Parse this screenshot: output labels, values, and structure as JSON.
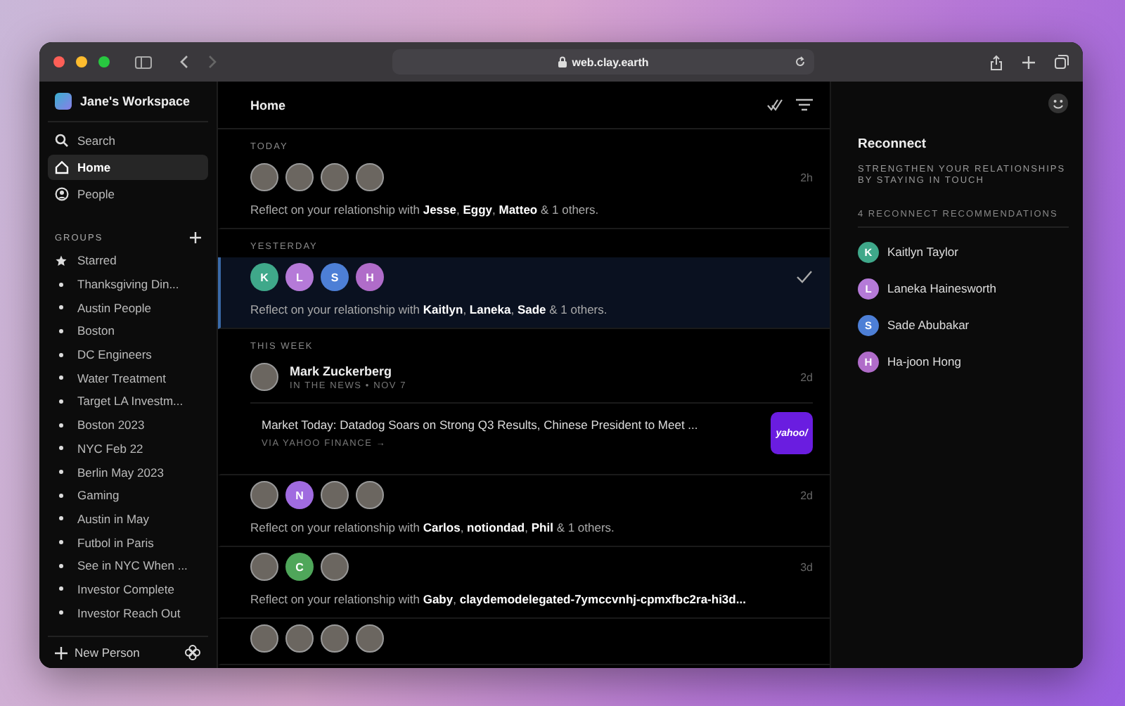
{
  "browser": {
    "url": "web.clay.earth"
  },
  "sidebar": {
    "workspace": "Jane's Workspace",
    "nav": [
      {
        "label": "Search",
        "kind": "search",
        "selected": false
      },
      {
        "label": "Home",
        "kind": "home",
        "selected": true
      },
      {
        "label": "People",
        "kind": "people",
        "selected": false
      }
    ],
    "groups_title": "GROUPS",
    "groups": [
      {
        "label": "Starred",
        "kind": "starred"
      },
      {
        "label": "Thanksgiving Din...",
        "kind": "group"
      },
      {
        "label": "Austin People",
        "kind": "group"
      },
      {
        "label": "Boston",
        "kind": "group"
      },
      {
        "label": "DC Engineers",
        "kind": "group"
      },
      {
        "label": "Water Treatment",
        "kind": "group"
      },
      {
        "label": "Target LA Investm...",
        "kind": "group"
      },
      {
        "label": "Boston 2023",
        "kind": "group"
      },
      {
        "label": "NYC Feb 22",
        "kind": "group"
      },
      {
        "label": "Berlin May 2023",
        "kind": "group"
      },
      {
        "label": "Gaming",
        "kind": "group"
      },
      {
        "label": "Austin in May",
        "kind": "group"
      },
      {
        "label": "Futbol in Paris",
        "kind": "group"
      },
      {
        "label": "See in NYC When ...",
        "kind": "group"
      },
      {
        "label": "Investor Complete",
        "kind": "group"
      },
      {
        "label": "Investor Reach Out",
        "kind": "group"
      }
    ],
    "new_person": "New Person"
  },
  "main": {
    "title": "Home",
    "sections": [
      {
        "label": "TODAY",
        "items": [
          {
            "kind": "reflect",
            "selected": false,
            "time": "2h",
            "avatars": [
              {
                "kind": "photo"
              },
              {
                "kind": "photo"
              },
              {
                "kind": "photo"
              },
              {
                "kind": "photo"
              }
            ],
            "text": "Reflect on your relationship with **Jesse**, **Eggy**, **Matteo** & 1 others."
          }
        ]
      },
      {
        "label": "YESTERDAY",
        "items": [
          {
            "kind": "reflect",
            "selected": true,
            "avatars": [
              {
                "kind": "letter",
                "letter": "K",
                "color": "#3fa88a"
              },
              {
                "kind": "letter",
                "letter": "L",
                "color": "#b57ad8"
              },
              {
                "kind": "letter",
                "letter": "S",
                "color": "#4d7fd6"
              },
              {
                "kind": "letter",
                "letter": "H",
                "color": "#b06cc9"
              }
            ],
            "text": "Reflect on your relationship with **Kaitlyn**, **Laneka**, **Sade** & 1 others."
          }
        ]
      },
      {
        "label": "THIS WEEK",
        "items": [
          {
            "kind": "news",
            "selected": false,
            "time": "2d",
            "name": "Mark Zuckerberg",
            "meta": "IN THE NEWS • NOV 7",
            "headline": "Market Today: Datadog Soars on Strong Q3 Results, Chinese President to Meet ...",
            "source": "VIA YAHOO FINANCE →",
            "logo": "yahoo/"
          },
          {
            "kind": "reflect",
            "selected": false,
            "time": "2d",
            "avatars": [
              {
                "kind": "photo"
              },
              {
                "kind": "letter",
                "letter": "N",
                "color": "#a06be0"
              },
              {
                "kind": "photo"
              },
              {
                "kind": "photo"
              }
            ],
            "text": "Reflect on your relationship with **Carlos**, **notiondad**, **Phil** & 1 others."
          },
          {
            "kind": "reflect",
            "selected": false,
            "time": "3d",
            "avatars": [
              {
                "kind": "photo"
              },
              {
                "kind": "letter",
                "letter": "C",
                "color": "#4fa65a"
              },
              {
                "kind": "photo"
              }
            ],
            "text": "Reflect on your relationship with **Gaby**, **claydemodelegated-7ymccvnhj-cpmxfbc2ra-hi3d...**"
          },
          {
            "kind": "reflect",
            "selected": false,
            "avatars": [
              {
                "kind": "photo"
              },
              {
                "kind": "photo"
              },
              {
                "kind": "photo"
              },
              {
                "kind": "photo"
              }
            ]
          }
        ]
      }
    ]
  },
  "panel": {
    "title": "Reconnect",
    "subtitle": "STRENGTHEN YOUR RELATIONSHIPS BY STAYING IN TOUCH",
    "count": "4 RECONNECT RECOMMENDATIONS",
    "people": [
      {
        "name": "Kaitlyn Taylor",
        "letter": "K",
        "color": "#3fa88a"
      },
      {
        "name": "Laneka Hainesworth",
        "letter": "L",
        "color": "#b57ad8"
      },
      {
        "name": "Sade Abubakar",
        "letter": "S",
        "color": "#4d7fd6"
      },
      {
        "name": "Ha-joon Hong",
        "letter": "H",
        "color": "#b06cc9"
      }
    ]
  }
}
